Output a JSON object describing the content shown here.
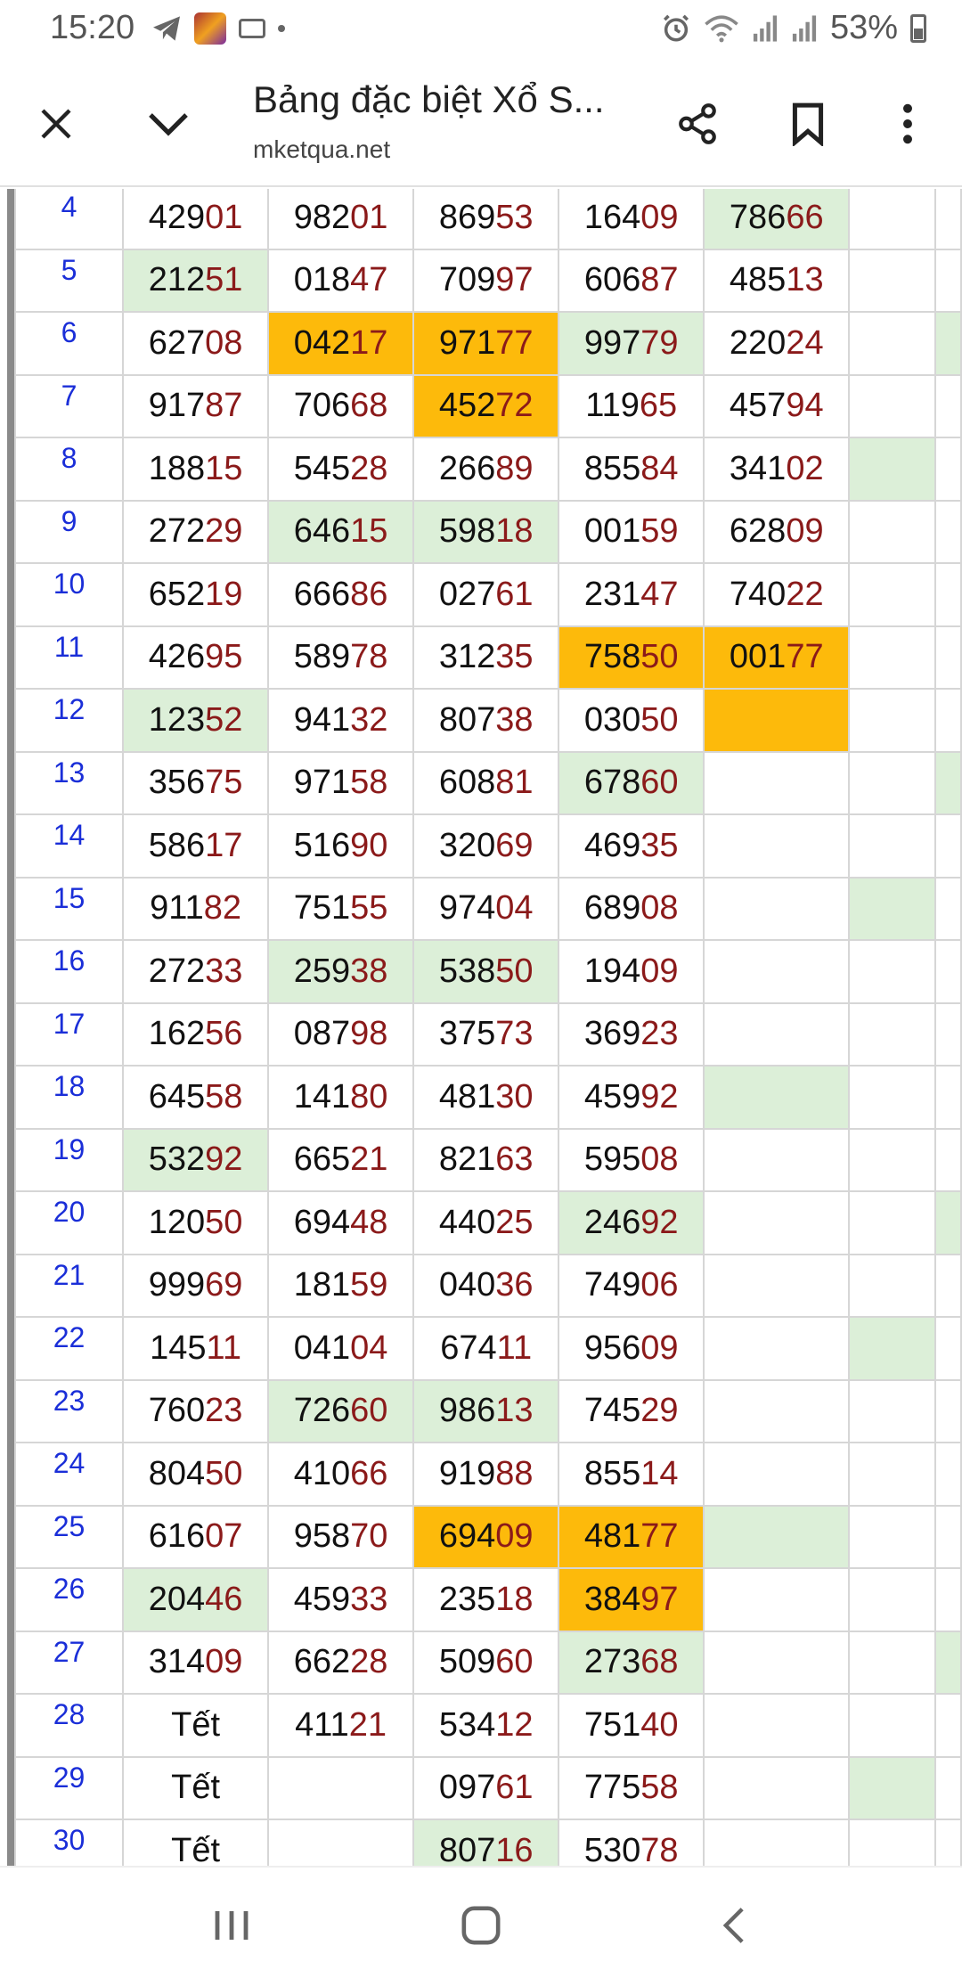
{
  "status": {
    "time": "15:20",
    "battery": "53%",
    "icons": [
      "telegram-icon",
      "app-thumbnail-icon",
      "keyboard-icon",
      "dot-icon",
      "alarm-icon",
      "wifi-icon",
      "signal-icon",
      "signal-icon",
      "battery-icon"
    ]
  },
  "toolbar": {
    "title": "Bảng đặc biệt Xổ S...",
    "url": "mketqua.net",
    "icons": [
      "close-icon",
      "chevron-down-icon",
      "share-icon",
      "bookmark-icon",
      "more-vert-icon"
    ]
  },
  "colors": {
    "green": "#dcefd8",
    "orange": "#fdba0b",
    "day": "#1a2ed8",
    "last_digits": "#8b1a1a"
  },
  "rows": [
    {
      "day": "4",
      "cells": [
        {
          "t": "42901",
          "h": ""
        },
        {
          "t": "98201",
          "h": ""
        },
        {
          "t": "86953",
          "h": ""
        },
        {
          "t": "16409",
          "h": ""
        },
        {
          "t": "78666",
          "h": "g"
        }
      ],
      "e": [
        "",
        ""
      ]
    },
    {
      "day": "5",
      "cells": [
        {
          "t": "21251",
          "h": "g"
        },
        {
          "t": "01847",
          "h": ""
        },
        {
          "t": "70997",
          "h": ""
        },
        {
          "t": "60687",
          "h": ""
        },
        {
          "t": "48513",
          "h": ""
        }
      ],
      "e": [
        "",
        ""
      ]
    },
    {
      "day": "6",
      "cells": [
        {
          "t": "62708",
          "h": ""
        },
        {
          "t": "04217",
          "h": "o"
        },
        {
          "t": "97177",
          "h": "o"
        },
        {
          "t": "99779",
          "h": "g"
        },
        {
          "t": "22024",
          "h": ""
        }
      ],
      "e": [
        "",
        "g"
      ]
    },
    {
      "day": "7",
      "cells": [
        {
          "t": "91787",
          "h": ""
        },
        {
          "t": "70668",
          "h": ""
        },
        {
          "t": "45272",
          "h": "o"
        },
        {
          "t": "11965",
          "h": ""
        },
        {
          "t": "45794",
          "h": ""
        }
      ],
      "e": [
        "",
        ""
      ]
    },
    {
      "day": "8",
      "cells": [
        {
          "t": "18815",
          "h": ""
        },
        {
          "t": "54528",
          "h": ""
        },
        {
          "t": "26689",
          "h": ""
        },
        {
          "t": "85584",
          "h": ""
        },
        {
          "t": "34102",
          "h": ""
        }
      ],
      "e": [
        "g",
        ""
      ]
    },
    {
      "day": "9",
      "cells": [
        {
          "t": "27229",
          "h": ""
        },
        {
          "t": "64615",
          "h": "g"
        },
        {
          "t": "59818",
          "h": "g"
        },
        {
          "t": "00159",
          "h": ""
        },
        {
          "t": "62809",
          "h": ""
        }
      ],
      "e": [
        "",
        ""
      ]
    },
    {
      "day": "10",
      "cells": [
        {
          "t": "65219",
          "h": ""
        },
        {
          "t": "66686",
          "h": ""
        },
        {
          "t": "02761",
          "h": ""
        },
        {
          "t": "23147",
          "h": ""
        },
        {
          "t": "74022",
          "h": ""
        }
      ],
      "e": [
        "",
        ""
      ]
    },
    {
      "day": "11",
      "cells": [
        {
          "t": "42695",
          "h": ""
        },
        {
          "t": "58978",
          "h": ""
        },
        {
          "t": "31235",
          "h": ""
        },
        {
          "t": "75850",
          "h": "o"
        },
        {
          "t": "00177",
          "h": "o"
        }
      ],
      "e": [
        "",
        ""
      ]
    },
    {
      "day": "12",
      "cells": [
        {
          "t": "12352",
          "h": "g"
        },
        {
          "t": "94132",
          "h": ""
        },
        {
          "t": "80738",
          "h": ""
        },
        {
          "t": "03050",
          "h": ""
        },
        {
          "t": "",
          "h": "o"
        }
      ],
      "e": [
        "",
        ""
      ]
    },
    {
      "day": "13",
      "cells": [
        {
          "t": "35675",
          "h": ""
        },
        {
          "t": "97158",
          "h": ""
        },
        {
          "t": "60881",
          "h": ""
        },
        {
          "t": "67860",
          "h": "g"
        },
        {
          "t": "",
          "h": ""
        }
      ],
      "e": [
        "",
        "g"
      ]
    },
    {
      "day": "14",
      "cells": [
        {
          "t": "58617",
          "h": ""
        },
        {
          "t": "51690",
          "h": ""
        },
        {
          "t": "32069",
          "h": ""
        },
        {
          "t": "46935",
          "h": ""
        },
        {
          "t": "",
          "h": ""
        }
      ],
      "e": [
        "",
        ""
      ]
    },
    {
      "day": "15",
      "cells": [
        {
          "t": "91182",
          "h": ""
        },
        {
          "t": "75155",
          "h": ""
        },
        {
          "t": "97404",
          "h": ""
        },
        {
          "t": "68908",
          "h": ""
        },
        {
          "t": "",
          "h": ""
        }
      ],
      "e": [
        "g",
        ""
      ]
    },
    {
      "day": "16",
      "cells": [
        {
          "t": "27233",
          "h": ""
        },
        {
          "t": "25938",
          "h": "g"
        },
        {
          "t": "53850",
          "h": "g"
        },
        {
          "t": "19409",
          "h": ""
        },
        {
          "t": "",
          "h": ""
        }
      ],
      "e": [
        "",
        ""
      ]
    },
    {
      "day": "17",
      "cells": [
        {
          "t": "16256",
          "h": ""
        },
        {
          "t": "08798",
          "h": ""
        },
        {
          "t": "37573",
          "h": ""
        },
        {
          "t": "36923",
          "h": ""
        },
        {
          "t": "",
          "h": ""
        }
      ],
      "e": [
        "",
        ""
      ]
    },
    {
      "day": "18",
      "cells": [
        {
          "t": "64558",
          "h": ""
        },
        {
          "t": "14180",
          "h": ""
        },
        {
          "t": "48130",
          "h": ""
        },
        {
          "t": "45992",
          "h": ""
        },
        {
          "t": "",
          "h": "g"
        }
      ],
      "e": [
        "",
        ""
      ]
    },
    {
      "day": "19",
      "cells": [
        {
          "t": "53292",
          "h": "g"
        },
        {
          "t": "66521",
          "h": ""
        },
        {
          "t": "82163",
          "h": ""
        },
        {
          "t": "59508",
          "h": ""
        },
        {
          "t": "",
          "h": ""
        }
      ],
      "e": [
        "",
        ""
      ]
    },
    {
      "day": "20",
      "cells": [
        {
          "t": "12050",
          "h": ""
        },
        {
          "t": "69448",
          "h": ""
        },
        {
          "t": "44025",
          "h": ""
        },
        {
          "t": "24692",
          "h": "g"
        },
        {
          "t": "",
          "h": ""
        }
      ],
      "e": [
        "",
        "g"
      ]
    },
    {
      "day": "21",
      "cells": [
        {
          "t": "99969",
          "h": ""
        },
        {
          "t": "18159",
          "h": ""
        },
        {
          "t": "04036",
          "h": ""
        },
        {
          "t": "74906",
          "h": ""
        },
        {
          "t": "",
          "h": ""
        }
      ],
      "e": [
        "",
        ""
      ]
    },
    {
      "day": "22",
      "cells": [
        {
          "t": "14511",
          "h": ""
        },
        {
          "t": "04104",
          "h": ""
        },
        {
          "t": "67411",
          "h": ""
        },
        {
          "t": "95609",
          "h": ""
        },
        {
          "t": "",
          "h": ""
        }
      ],
      "e": [
        "g",
        ""
      ]
    },
    {
      "day": "23",
      "cells": [
        {
          "t": "76023",
          "h": ""
        },
        {
          "t": "72660",
          "h": "g"
        },
        {
          "t": "98613",
          "h": "g"
        },
        {
          "t": "74529",
          "h": ""
        },
        {
          "t": "",
          "h": ""
        }
      ],
      "e": [
        "",
        ""
      ]
    },
    {
      "day": "24",
      "cells": [
        {
          "t": "80450",
          "h": ""
        },
        {
          "t": "41066",
          "h": ""
        },
        {
          "t": "91988",
          "h": ""
        },
        {
          "t": "85514",
          "h": ""
        },
        {
          "t": "",
          "h": ""
        }
      ],
      "e": [
        "",
        ""
      ]
    },
    {
      "day": "25",
      "cells": [
        {
          "t": "61607",
          "h": ""
        },
        {
          "t": "95870",
          "h": ""
        },
        {
          "t": "69409",
          "h": "o"
        },
        {
          "t": "48177",
          "h": "o"
        },
        {
          "t": "",
          "h": "g"
        }
      ],
      "e": [
        "",
        ""
      ]
    },
    {
      "day": "26",
      "cells": [
        {
          "t": "20446",
          "h": "g"
        },
        {
          "t": "45933",
          "h": ""
        },
        {
          "t": "23518",
          "h": ""
        },
        {
          "t": "38497",
          "h": "o"
        },
        {
          "t": "",
          "h": ""
        }
      ],
      "e": [
        "",
        ""
      ]
    },
    {
      "day": "27",
      "cells": [
        {
          "t": "31409",
          "h": ""
        },
        {
          "t": "66228",
          "h": ""
        },
        {
          "t": "50960",
          "h": ""
        },
        {
          "t": "27368",
          "h": "g"
        },
        {
          "t": "",
          "h": ""
        }
      ],
      "e": [
        "",
        "g"
      ]
    },
    {
      "day": "28",
      "cells": [
        {
          "t": "Tết",
          "h": ""
        },
        {
          "t": "41121",
          "h": ""
        },
        {
          "t": "53412",
          "h": ""
        },
        {
          "t": "75140",
          "h": ""
        },
        {
          "t": "",
          "h": ""
        }
      ],
      "e": [
        "",
        ""
      ]
    },
    {
      "day": "29",
      "cells": [
        {
          "t": "Tết",
          "h": ""
        },
        {
          "t": "",
          "h": ""
        },
        {
          "t": "09761",
          "h": ""
        },
        {
          "t": "77558",
          "h": ""
        },
        {
          "t": "",
          "h": ""
        }
      ],
      "e": [
        "g",
        ""
      ]
    },
    {
      "day": "30",
      "cells": [
        {
          "t": "Tết",
          "h": ""
        },
        {
          "t": "",
          "h": ""
        },
        {
          "t": "80716",
          "h": "g"
        },
        {
          "t": "53078",
          "h": ""
        },
        {
          "t": "",
          "h": ""
        }
      ],
      "e": [
        "",
        ""
      ]
    }
  ],
  "navbar": {
    "icons": [
      "recent-apps-icon",
      "home-icon",
      "back-icon"
    ]
  }
}
